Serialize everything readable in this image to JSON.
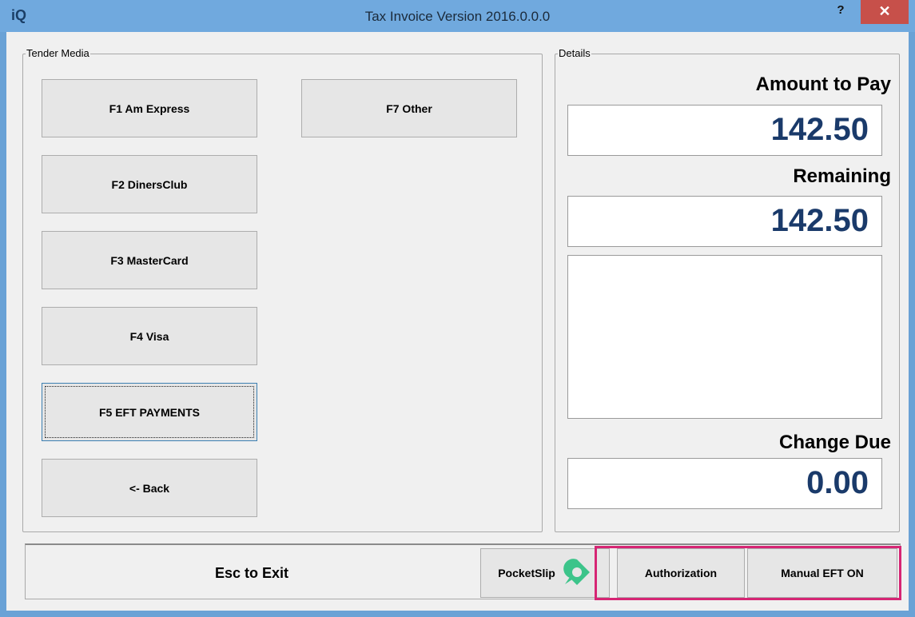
{
  "window": {
    "logo": "iQ",
    "title": "Tax Invoice Version 2016.0.0.0",
    "help_label": "?",
    "close_label": "✕"
  },
  "tender_media": {
    "label": "Tender Media",
    "buttons": [
      {
        "label": "F1 Am Express"
      },
      {
        "label": "F2 DinersClub"
      },
      {
        "label": "F3 MasterCard"
      },
      {
        "label": "F4 Visa"
      },
      {
        "label": "F5 EFT PAYMENTS"
      },
      {
        "label": "<- Back"
      },
      {
        "label": "F7 Other"
      }
    ]
  },
  "details": {
    "label": "Details",
    "amount_to_pay_label": "Amount to Pay",
    "amount_to_pay_value": "142.50",
    "remaining_label": "Remaining",
    "remaining_value": "142.50",
    "change_due_label": "Change Due",
    "change_due_value": "0.00"
  },
  "footer": {
    "exit_label": "Esc to Exit",
    "pocketslip_label": "PocketSlip",
    "authorization_label": "Authorization",
    "manual_eft_label": "Manual EFT ON"
  },
  "colors": {
    "amount_text": "#1a3a6a",
    "highlight": "#d62574",
    "pocketslip_icon": "#3cc48a"
  }
}
